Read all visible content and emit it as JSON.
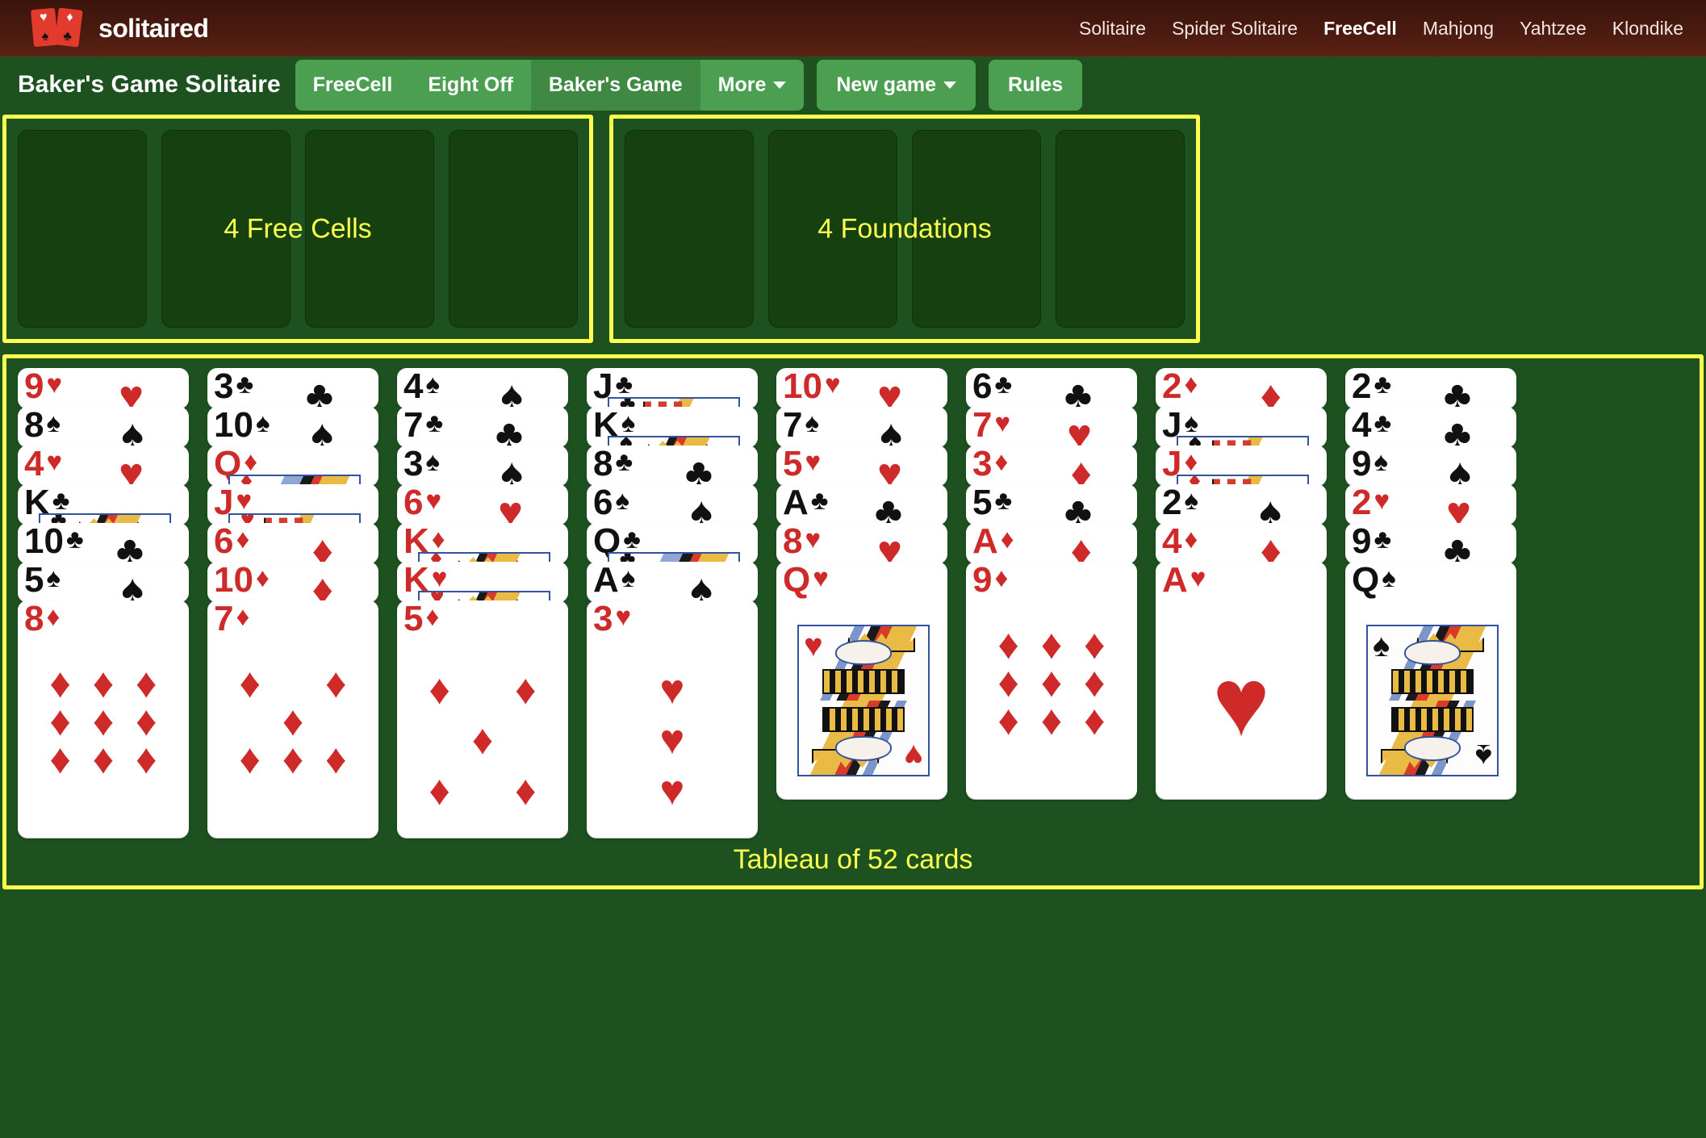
{
  "brand": {
    "name": "solitaired",
    "card_pips": [
      "♥",
      "♠",
      "♦",
      "♣"
    ]
  },
  "nav": {
    "items": [
      {
        "label": "Solitaire",
        "active": false
      },
      {
        "label": "Spider Solitaire",
        "active": false
      },
      {
        "label": "FreeCell",
        "active": true
      },
      {
        "label": "Mahjong",
        "active": false
      },
      {
        "label": "Yahtzee",
        "active": false
      },
      {
        "label": "Klondike",
        "active": false
      }
    ]
  },
  "toolbar": {
    "game_title": "Baker's Game Solitaire",
    "variants": [
      {
        "label": "FreeCell",
        "selected": false
      },
      {
        "label": "Eight Off",
        "selected": false
      },
      {
        "label": "Baker's Game",
        "selected": true
      },
      {
        "label": "More",
        "selected": false,
        "caret": true
      }
    ],
    "new_game_label": "New game",
    "new_game_caret": true,
    "rules_label": "Rules"
  },
  "annotations": {
    "free_cells": "4 Free Cells",
    "foundations": "4 Foundations",
    "tableau": "Tableau of 52 cards",
    "highlight_color": "#ffff4d"
  },
  "free_cells": {
    "count": 4,
    "cards": [
      null,
      null,
      null,
      null
    ]
  },
  "foundations": {
    "count": 4,
    "cards": [
      null,
      null,
      null,
      null
    ]
  },
  "tableau": {
    "columns": [
      [
        "9♥",
        "8♠",
        "4♥",
        "K♣",
        "10♣",
        "5♠",
        "8♦"
      ],
      [
        "3♣",
        "10♠",
        "Q♦",
        "J♥",
        "6♦",
        "10♦",
        "7♦"
      ],
      [
        "4♠",
        "7♣",
        "3♠",
        "6♥",
        "K♦",
        "K♥",
        "5♦"
      ],
      [
        "J♣",
        "K♠",
        "8♣",
        "6♠",
        "Q♣",
        "A♠",
        "3♥"
      ],
      [
        "10♥",
        "7♠",
        "5♥",
        "A♣",
        "8♥",
        "Q♥"
      ],
      [
        "6♣",
        "7♥",
        "3♦",
        "5♣",
        "A♦",
        "9♦"
      ],
      [
        "2♦",
        "J♠",
        "J♦",
        "2♠",
        "4♦",
        "A♥"
      ],
      [
        "2♣",
        "4♣",
        "9♠",
        "2♥",
        "9♣",
        "Q♠"
      ]
    ]
  },
  "colors": {
    "table_green": "#1d5120",
    "slot_green": "#16400f",
    "header_brown": "#4a1a10",
    "button_green": "#4c9f50",
    "button_green_selected": "#3f8943",
    "red_suit": "#cf2a2a",
    "black_suit": "#111111"
  }
}
